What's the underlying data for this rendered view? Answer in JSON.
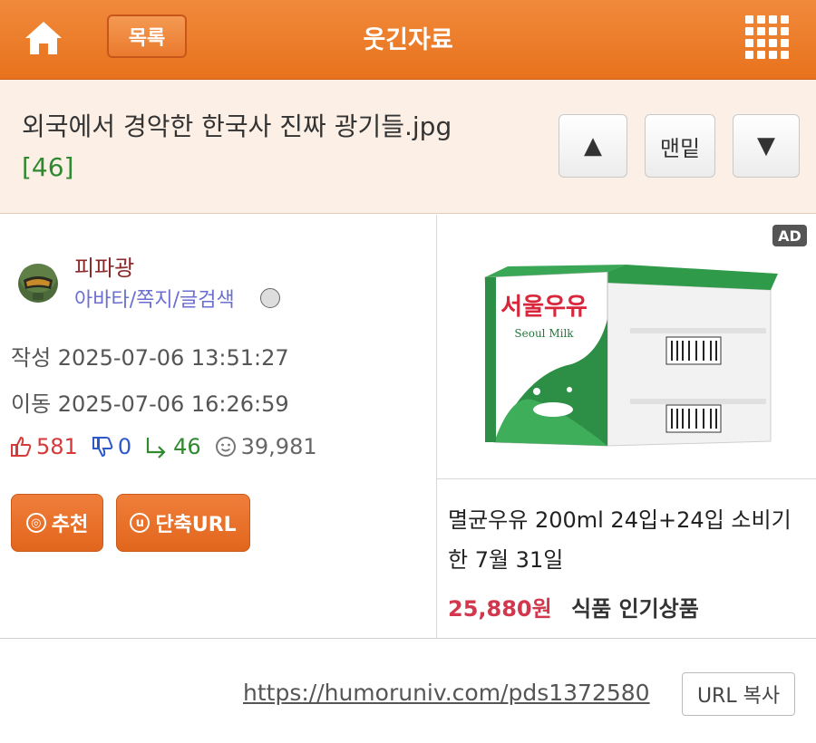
{
  "topbar": {
    "home_icon": "home-icon",
    "list_label": "목록",
    "page_name": "웃긴자료",
    "menu_icon": "grid-menu-icon"
  },
  "post": {
    "title": "외국에서 경악한 한국사 진짜 광기들.jpg",
    "comment_count": "[46]"
  },
  "nav": {
    "up_symbol": "▲",
    "bottom_label": "맨밑",
    "down_symbol": "▼"
  },
  "author": {
    "name": "피파광",
    "links": "아바타/쪽지/글검색"
  },
  "meta": {
    "written": "작성 2025-07-06 13:51:27",
    "moved": "이동 2025-07-06 16:26:59"
  },
  "stats": {
    "likes": "581",
    "dislikes": "0",
    "replies": "46",
    "views": "39,981"
  },
  "actions": {
    "recommend_label": "추천",
    "recommend_glyph": "◎",
    "shorturl_label": "단축URL",
    "shorturl_glyph": "u"
  },
  "ad": {
    "tag": "AD",
    "product_name": "멸균우유 200ml 24입+24입 소비기한 7월 31일",
    "price": "25,880원",
    "category": "식품 인기상품",
    "brand_text": "서울우유",
    "brand_sub": "Seoul Milk"
  },
  "url": {
    "link": "https://humoruniv.com/pds1372580",
    "copy_label": "URL 복사"
  },
  "colors": {
    "brand_orange": "#e8721c",
    "title_band": "#fcefe5",
    "like_red": "#d43a3a",
    "dislike_blue": "#2c58c9",
    "reply_green": "#2f8a2f",
    "price_red": "#d2374d"
  }
}
